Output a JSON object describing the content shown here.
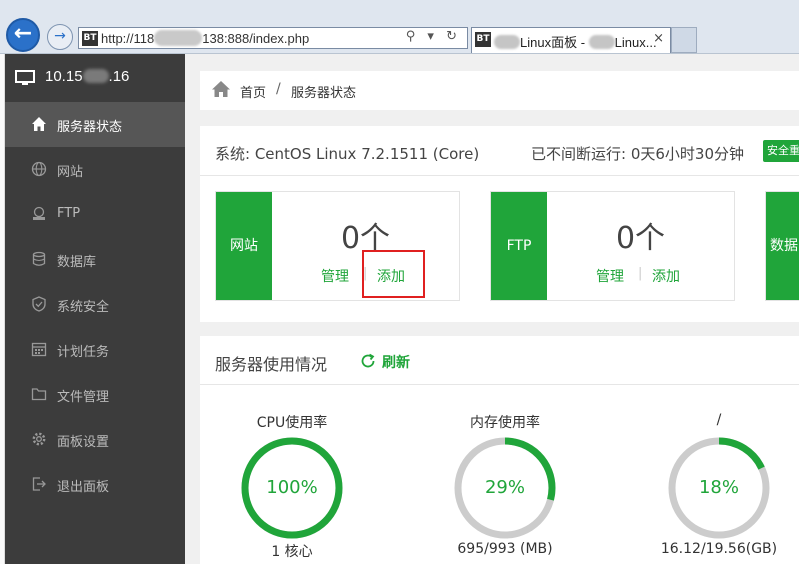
{
  "browser": {
    "address_prefix": "http://118",
    "address_suffix": "138:888/index.php",
    "address_icons": "⚲ ▾ ↻",
    "tab_prefix": "",
    "tab_title_mid": "Linux面板 - ",
    "tab_title_end": "Linux...",
    "tab_close": "×",
    "bt_badge": "BT"
  },
  "sidebar": {
    "server_ip_prefix": "10.15",
    "server_ip_suffix": ".16",
    "items": [
      {
        "label": "服务器状态",
        "icon": "home-icon",
        "active": true
      },
      {
        "label": "网站",
        "icon": "globe-icon"
      },
      {
        "label": "FTP",
        "icon": "ftp-icon"
      },
      {
        "label": "数据库",
        "icon": "database-icon"
      },
      {
        "label": "系统安全",
        "icon": "shield-icon"
      },
      {
        "label": "计划任务",
        "icon": "calendar-icon"
      },
      {
        "label": "文件管理",
        "icon": "folder-icon"
      },
      {
        "label": "面板设置",
        "icon": "gear-icon"
      },
      {
        "label": "退出面板",
        "icon": "logout-icon"
      }
    ]
  },
  "breadcrumb": {
    "home": "首页",
    "separator": "/",
    "current": "服务器状态"
  },
  "system": {
    "name": "系统: CentOS Linux 7.2.1511 (Core)",
    "uptime": "已不间断运行: 0天6小时30分钟",
    "badge": "安全重"
  },
  "cards": [
    {
      "side": "网站",
      "count": "0个",
      "manage": "管理",
      "add": "添加"
    },
    {
      "side": "FTP",
      "count": "0个",
      "manage": "管理",
      "add": "添加"
    },
    {
      "side": "数据"
    }
  ],
  "usage": {
    "title": "服务器使用情况",
    "refresh": "刷新",
    "gauges": [
      {
        "label": "CPU使用率",
        "percent": 100,
        "value": "100%",
        "detail": "1 核心"
      },
      {
        "label": "内存使用率",
        "percent": 29,
        "value": "29%",
        "detail": "695/993 (MB)"
      },
      {
        "label": "/",
        "percent": 18,
        "value": "18%",
        "detail": "16.12/19.56(GB)"
      }
    ]
  },
  "colors": {
    "accent": "#20a53a",
    "sidebar": "#3c3c3c",
    "highlight": "#e02020",
    "ring_track": "#cccccc"
  }
}
